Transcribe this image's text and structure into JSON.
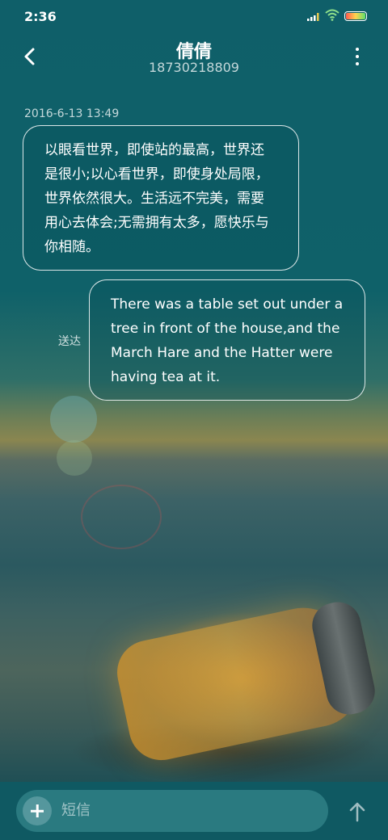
{
  "status_bar": {
    "time": "2:36",
    "icons": [
      "signal-icon",
      "wifi-icon",
      "battery-icon"
    ]
  },
  "header": {
    "contact_name": "倩倩",
    "contact_number": "18730218809",
    "back_icon": "chevron-left-icon",
    "more_icon": "more-vertical-icon"
  },
  "conversation": {
    "timestamp": "2016-6-13 13:49",
    "messages": [
      {
        "direction": "incoming",
        "text": "以眼看世界，即使站的最高，世界还是很小;以心看世界，即使身处局限，世界依然很大。生活远不完美，需要用心去体会;无需拥有太多，愿快乐与你相随。"
      },
      {
        "direction": "outgoing",
        "text": "There was a table set out under a tree in front of the house,and the March Hare and the Hatter were having tea at it.",
        "status": "送达"
      }
    ]
  },
  "composer": {
    "placeholder": "短信",
    "add_icon": "plus-icon",
    "send_icon": "arrow-up-icon"
  },
  "colors": {
    "primary_bg": "#0f5a63",
    "bubble_border": "#ffffff",
    "composer_bg": "#2d7d84"
  }
}
